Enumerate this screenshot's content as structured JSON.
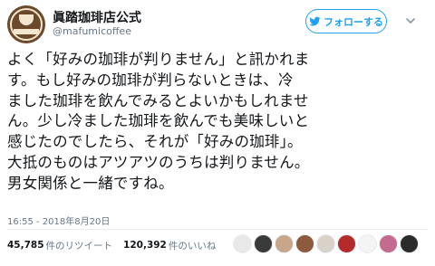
{
  "account": {
    "name": "眞踏珈琲店公式",
    "handle": "@mafumicoffee"
  },
  "follow_button": {
    "label": "フォローする"
  },
  "tweet": {
    "lines": [
      "よく「好みの珈琲が判りません」と訊かれま",
      "す。もし好みの珈琲が判らないときは、冷",
      "ました珈琲を飲んでみるとよいかもしれませ",
      "ん。少し冷ました珈琲を飲んでも美味しいと",
      "感じたのでしたら、それが「好みの珈琲」。",
      "大抵のものはアツアツのうちは判りません。",
      "男女関係と一緒ですね。"
    ],
    "timestamp": "16:55 - 2018年8月20日"
  },
  "stats": {
    "retweets": "45,785",
    "retweets_label": "件のリツイート",
    "likes": "120,392",
    "likes_label": "件のいいね"
  },
  "likers": [
    {
      "color": "#e9e9e9"
    },
    {
      "color": "#3a3a3a"
    },
    {
      "color": "#c9a58a"
    },
    {
      "color": "#8c5a3c"
    },
    {
      "color": "#d8d2c8"
    },
    {
      "color": "#b52a2a"
    },
    {
      "color": "#f4f4f4"
    },
    {
      "color": "#c46b8f"
    },
    {
      "color": "#2b2b2b"
    }
  ],
  "colors": {
    "accent": "#1da1f2",
    "text": "#14171a",
    "muted": "#657786"
  }
}
